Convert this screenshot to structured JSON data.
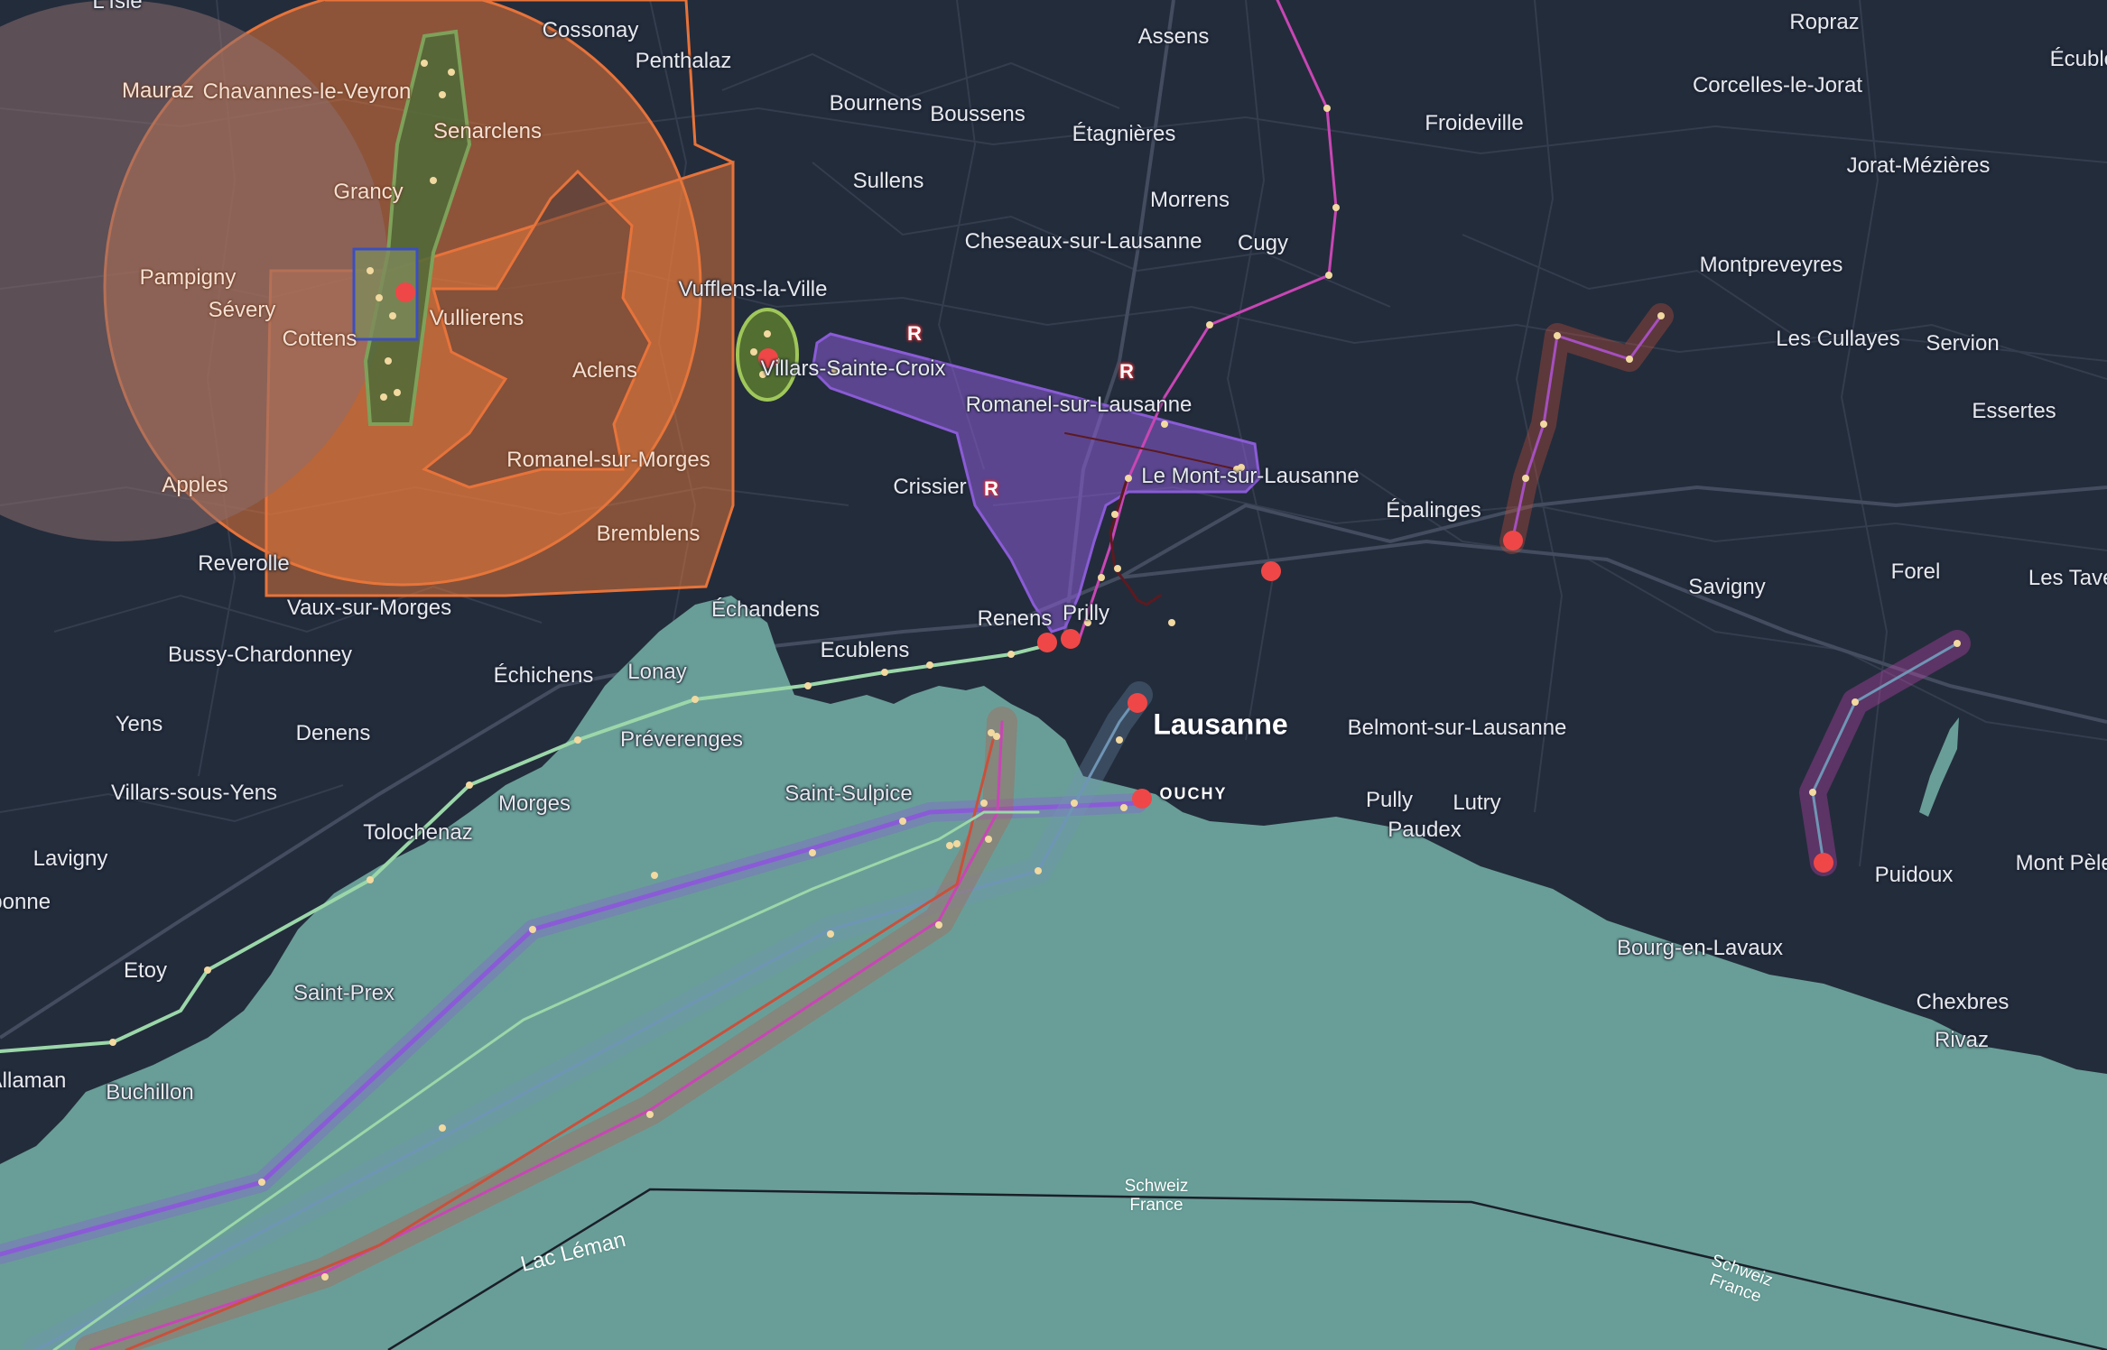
{
  "map": {
    "colors": {
      "land": "#232c3b",
      "water": "#699e98",
      "roads": "#3a4354",
      "restricted_zone": "#e6773a",
      "marker": "#ef4747",
      "route_purple": "#8a5bd6",
      "route_magenta": "#c846b4",
      "route_green": "#9bd7a9",
      "route_blue": "#6f95b5",
      "route_red": "#c8513c"
    },
    "places": [
      {
        "name": "L'Isle"
      },
      {
        "name": "Cossonay"
      },
      {
        "name": "Penthalaz"
      },
      {
        "name": "Mauraz"
      },
      {
        "name": "Chavannes-le-Veyron"
      },
      {
        "name": "Senarclens"
      },
      {
        "name": "Grancy"
      },
      {
        "name": "Pampigny"
      },
      {
        "name": "Sévery"
      },
      {
        "name": "Cottens"
      },
      {
        "name": "Vullierens"
      },
      {
        "name": "Aclens"
      },
      {
        "name": "Romanel-sur-Morges"
      },
      {
        "name": "Apples"
      },
      {
        "name": "Bremblens"
      },
      {
        "name": "Reverolle"
      },
      {
        "name": "Vaux-sur-Morges"
      },
      {
        "name": "Bussy-Chardonney"
      },
      {
        "name": "Échichens"
      },
      {
        "name": "Lonay"
      },
      {
        "name": "Yens"
      },
      {
        "name": "Denens"
      },
      {
        "name": "Villars-sous-Yens"
      },
      {
        "name": "Morges"
      },
      {
        "name": "Tolochenaz"
      },
      {
        "name": "Lavigny"
      },
      {
        "name": "Aubonne"
      },
      {
        "name": "Etoy"
      },
      {
        "name": "Saint-Prex"
      },
      {
        "name": "Allaman"
      },
      {
        "name": "Buchillon"
      },
      {
        "name": "Assens"
      },
      {
        "name": "Bournens"
      },
      {
        "name": "Boussens"
      },
      {
        "name": "Étagnières"
      },
      {
        "name": "Sullens"
      },
      {
        "name": "Morrens"
      },
      {
        "name": "Cheseaux-sur-Lausanne"
      },
      {
        "name": "Cugy"
      },
      {
        "name": "Vufflens-la-Ville"
      },
      {
        "name": "Villars-Sainte-Croix"
      },
      {
        "name": "Romanel-sur-Lausanne"
      },
      {
        "name": "Crissier"
      },
      {
        "name": "Le Mont-sur-Lausanne"
      },
      {
        "name": "Échandens"
      },
      {
        "name": "Ecublens"
      },
      {
        "name": "Renens"
      },
      {
        "name": "Prilly"
      },
      {
        "name": "Préverenges"
      },
      {
        "name": "Saint-Sulpice"
      },
      {
        "name": "Lausanne"
      },
      {
        "name": "OUCHY"
      },
      {
        "name": "Froideville"
      },
      {
        "name": "Ropraz"
      },
      {
        "name": "Corcelles-le-Jorat"
      },
      {
        "name": "Écublens"
      },
      {
        "name": "Jorat-Mézières"
      },
      {
        "name": "Montpreveyres"
      },
      {
        "name": "Les Cullayes"
      },
      {
        "name": "Servion"
      },
      {
        "name": "Essertes"
      },
      {
        "name": "Épalinges"
      },
      {
        "name": "Savigny"
      },
      {
        "name": "Forel"
      },
      {
        "name": "Les Tavernes"
      },
      {
        "name": "Belmont-sur-Lausanne"
      },
      {
        "name": "Pully"
      },
      {
        "name": "Lutry"
      },
      {
        "name": "Paudex"
      },
      {
        "name": "Puidoux"
      },
      {
        "name": "Mont Pèlerin"
      },
      {
        "name": "Bourg-en-Lavaux"
      },
      {
        "name": "Chexbres"
      },
      {
        "name": "Rivaz"
      },
      {
        "name": "Lac Léman"
      },
      {
        "name": "Schweiz\nFrance"
      },
      {
        "name": "Schweiz\nFrance"
      }
    ],
    "restricted_markers": [
      "R",
      "R",
      "R"
    ],
    "marker_count": 12
  }
}
